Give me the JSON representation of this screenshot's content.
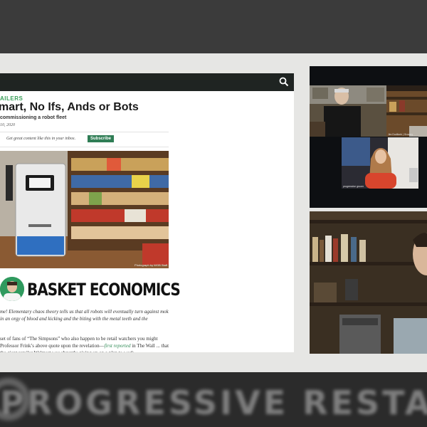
{
  "article": {
    "category": "AILERS",
    "headline": "mart, No Ifs, Ands or Bots",
    "subhead": "commissioning a robot fleet",
    "date": "10, 2020",
    "promo_text": "Get great content like this in your inbox.",
    "subscribe_label": "Subscribe",
    "photo_credit": "Photograph by WGB Staff",
    "column_name": "BASKET ECONOMICS",
    "para1": "me! Elementary chaos theory tells us that all robots will eventually turn against mok in an orgy of blood and kicking and the biting with the metal teeth and the",
    "para2_before": "set of fans of “The Simpsons” who also happen to be retail watchers you might Professor Frink’s above quote upon the revelation—",
    "para2_link": "first reported",
    "para2_after": " in The Wall ... that the giant retailer Walmart was abruptly giving up on a plan to work"
  },
  "video_tiles": {
    "tile1_name": "Jim Dudlicek | Grocery",
    "tile2_name": "progressive grocer"
  },
  "background": {
    "blurred_text": "PROGRESSIVE   RESTAURANT"
  },
  "icons": {
    "search": "search-icon"
  },
  "colors": {
    "accent_green": "#2f7d55",
    "site_bar": "#1f2422",
    "link_green": "#2f8a55"
  }
}
